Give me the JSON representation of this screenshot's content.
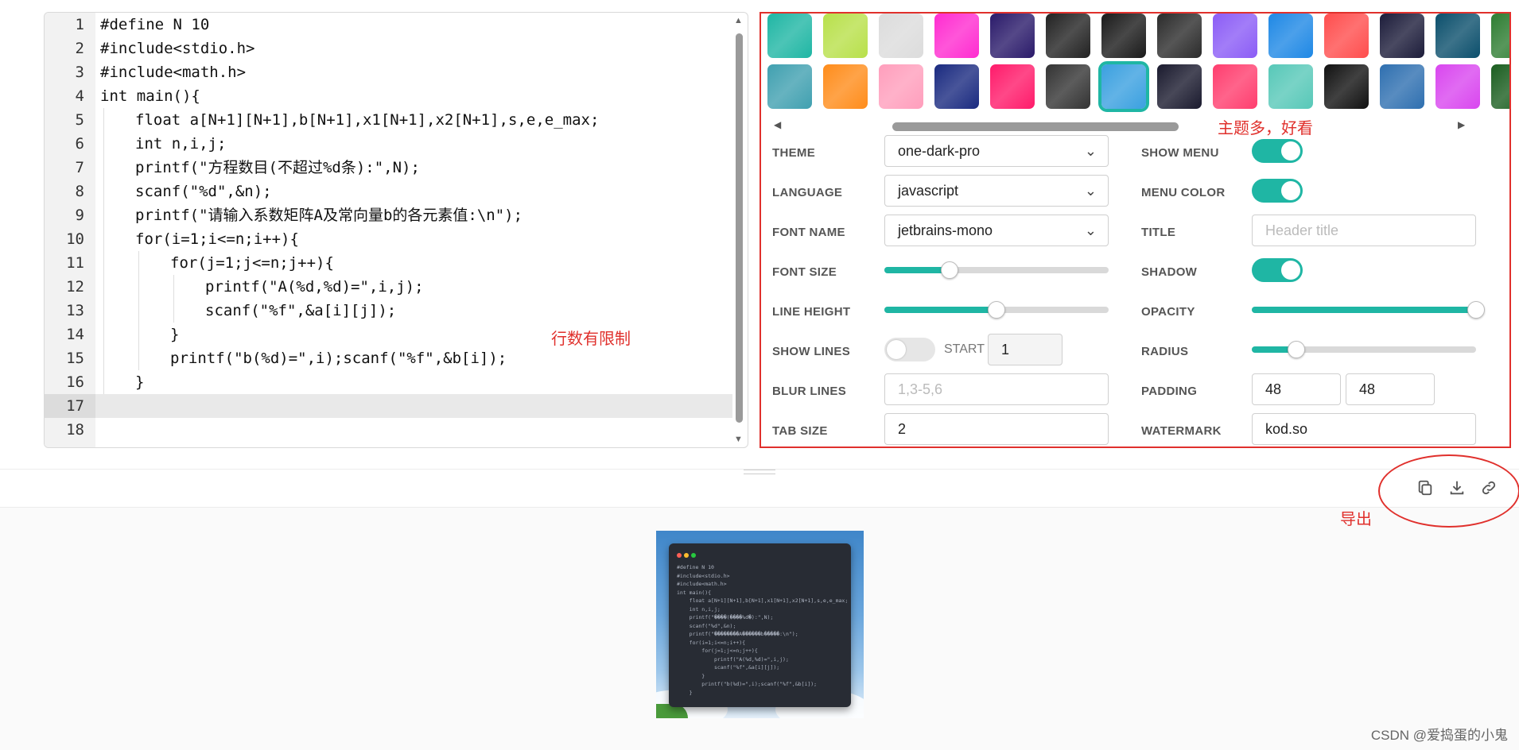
{
  "editor": {
    "lines": [
      {
        "n": "1",
        "code": "#define N 10",
        "indent": 0
      },
      {
        "n": "2",
        "code": "#include<stdio.h>",
        "indent": 0
      },
      {
        "n": "3",
        "code": "#include<math.h>",
        "indent": 0
      },
      {
        "n": "4",
        "code": "int main(){",
        "indent": 0
      },
      {
        "n": "5",
        "code": "float a[N+1][N+1],b[N+1],x1[N+1],x2[N+1],s,e,e_max;",
        "indent": 1
      },
      {
        "n": "6",
        "code": "int n,i,j;",
        "indent": 1
      },
      {
        "n": "7",
        "code": "printf(\"方程数目(不超过%d条):\",N);",
        "indent": 1
      },
      {
        "n": "8",
        "code": "scanf(\"%d\",&n);",
        "indent": 1
      },
      {
        "n": "9",
        "code": "printf(\"请输入系数矩阵A及常向量b的各元素值:\\n\");",
        "indent": 1
      },
      {
        "n": "10",
        "code": "for(i=1;i<=n;i++){",
        "indent": 1
      },
      {
        "n": "11",
        "code": "for(j=1;j<=n;j++){",
        "indent": 2
      },
      {
        "n": "12",
        "code": "printf(\"A(%d,%d)=\",i,j);",
        "indent": 3
      },
      {
        "n": "13",
        "code": "scanf(\"%f\",&a[i][j]);",
        "indent": 3
      },
      {
        "n": "14",
        "code": "}",
        "indent": 2
      },
      {
        "n": "15",
        "code": "printf(\"b(%d)=\",i);scanf(\"%f\",&b[i]);",
        "indent": 2
      },
      {
        "n": "16",
        "code": "}",
        "indent": 1
      },
      {
        "n": "17",
        "code": "",
        "indent": 0
      },
      {
        "n": "18",
        "code": "",
        "indent": 0
      }
    ],
    "active_line": "17"
  },
  "annotations": {
    "line_limit": "行数有限制",
    "themes": "主题多，好看",
    "export": "导出"
  },
  "themes": {
    "row1": [
      "#1fb6a4",
      "#b8e04a",
      "#dcdcdc",
      "#ff2bd0",
      "#2a1a6a",
      "#222222",
      "#1a1a1a",
      "#2b2b2b",
      "#8b5cf6",
      "#1e88e5",
      "#ff4d4d",
      "#1c1c3a",
      "#0b4f6c",
      "#2e7d32"
    ],
    "row2": [
      "#40a0b0",
      "#ff8c1a",
      "#ff9ebc",
      "#1a2a80",
      "#ff1a6a",
      "#333333",
      "#3aa0e0",
      "#1a1a2e",
      "#ff3d6e",
      "#57c8b8",
      "#111111",
      "#2e6fb0",
      "#d946ef",
      "#1b5e20"
    ],
    "selected_index": 6
  },
  "settings": {
    "theme_label": "THEME",
    "theme_value": "one-dark-pro",
    "language_label": "LANGUAGE",
    "language_value": "javascript",
    "font_name_label": "FONT NAME",
    "font_name_value": "jetbrains-mono",
    "font_size_label": "FONT SIZE",
    "font_size_level": 0.29,
    "line_height_label": "LINE HEIGHT",
    "line_height_level": 0.5,
    "show_lines_label": "SHOW LINES",
    "show_lines_on": false,
    "start_label": "START",
    "start_value": "1",
    "blur_lines_label": "BLUR LINES",
    "blur_lines_placeholder": "1,3-5,6",
    "tab_size_label": "TAB SIZE",
    "tab_size_value": "2",
    "show_menu_label": "SHOW MENU",
    "show_menu_on": true,
    "menu_color_label": "MENU COLOR",
    "menu_color_on": true,
    "title_label": "TITLE",
    "title_placeholder": "Header title",
    "shadow_label": "SHADOW",
    "shadow_on": true,
    "opacity_label": "OPACITY",
    "opacity_level": 1.0,
    "radius_label": "RADIUS",
    "radius_level": 0.2,
    "padding_label": "PADDING",
    "padding_x": "48",
    "padding_y": "48",
    "watermark_label": "WATERMARK",
    "watermark_value": "kod.so"
  },
  "export_icons": [
    "copy-icon",
    "download-icon",
    "link-icon"
  ],
  "preview": {
    "lines": [
      "#define N 10",
      "#include<stdio.h>",
      "#include<math.h>",
      "int main(){",
      "    float a[N+1][N+1],b[N+1],x1[N+1],x2[N+1],s,e,e_max;",
      "    int n,i,j;",
      "    printf(\"����(����%d�):\",N);",
      "    scanf(\"%d\",&n);",
      "    printf(\"��������A������b�����:\\n\");",
      "    for(i=1;i<=n;i++){",
      "        for(j=1;j<=n;j++){",
      "            printf(\"A(%d,%d)=\",i,j);",
      "            scanf(\"%f\",&a[i][j]);",
      "        }",
      "        printf(\"b(%d)=\",i);scanf(\"%f\",&b[i]);",
      "    }"
    ]
  },
  "footer": {
    "watermark": "CSDN @爱捣蛋的小鬼"
  }
}
